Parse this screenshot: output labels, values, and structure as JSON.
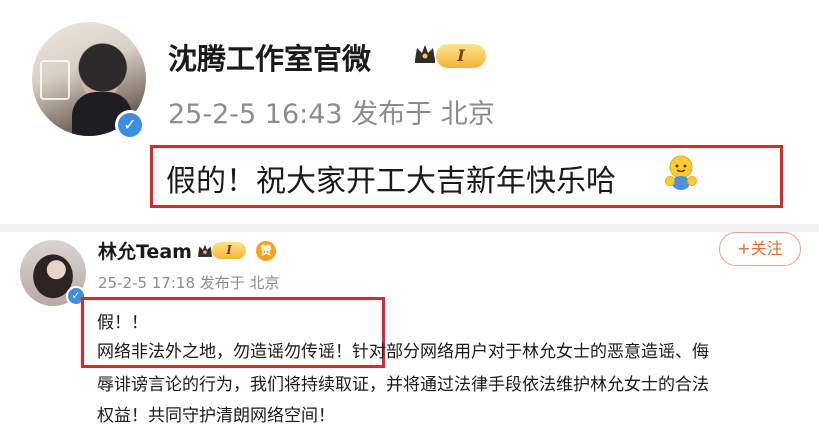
{
  "post1": {
    "author": "沈腾工作室官微",
    "level": "I",
    "meta": "25-2-5 16:43 发布于 北京",
    "text": "假的！祝大家开工大吉新年快乐哈"
  },
  "post2": {
    "author": "林允Team",
    "level": "I",
    "badge": "赞",
    "meta": "25-2-5 17:18 发布于 北京",
    "follow_label": "+关注",
    "lines": [
      "假！！",
      "网络非法外之地，勿造谣勿传谣！针对部分网络用户对于林允女士的恶意造谣、侮",
      "辱诽谤言论的行为，我们将持续取证，并将通过法律手段依法维护林允女士的合法",
      "权益！共同守护清朗网络空间！"
    ]
  },
  "colors": {
    "highlight_box": "#e3242b",
    "follow_accent": "#e86b2c",
    "verify_blue": "#3d8ee3",
    "meta_gray": "#8c8c8c"
  },
  "icons": [
    "verified-icon",
    "crown-icon",
    "emoji-hug-icon",
    "badge-icon"
  ]
}
